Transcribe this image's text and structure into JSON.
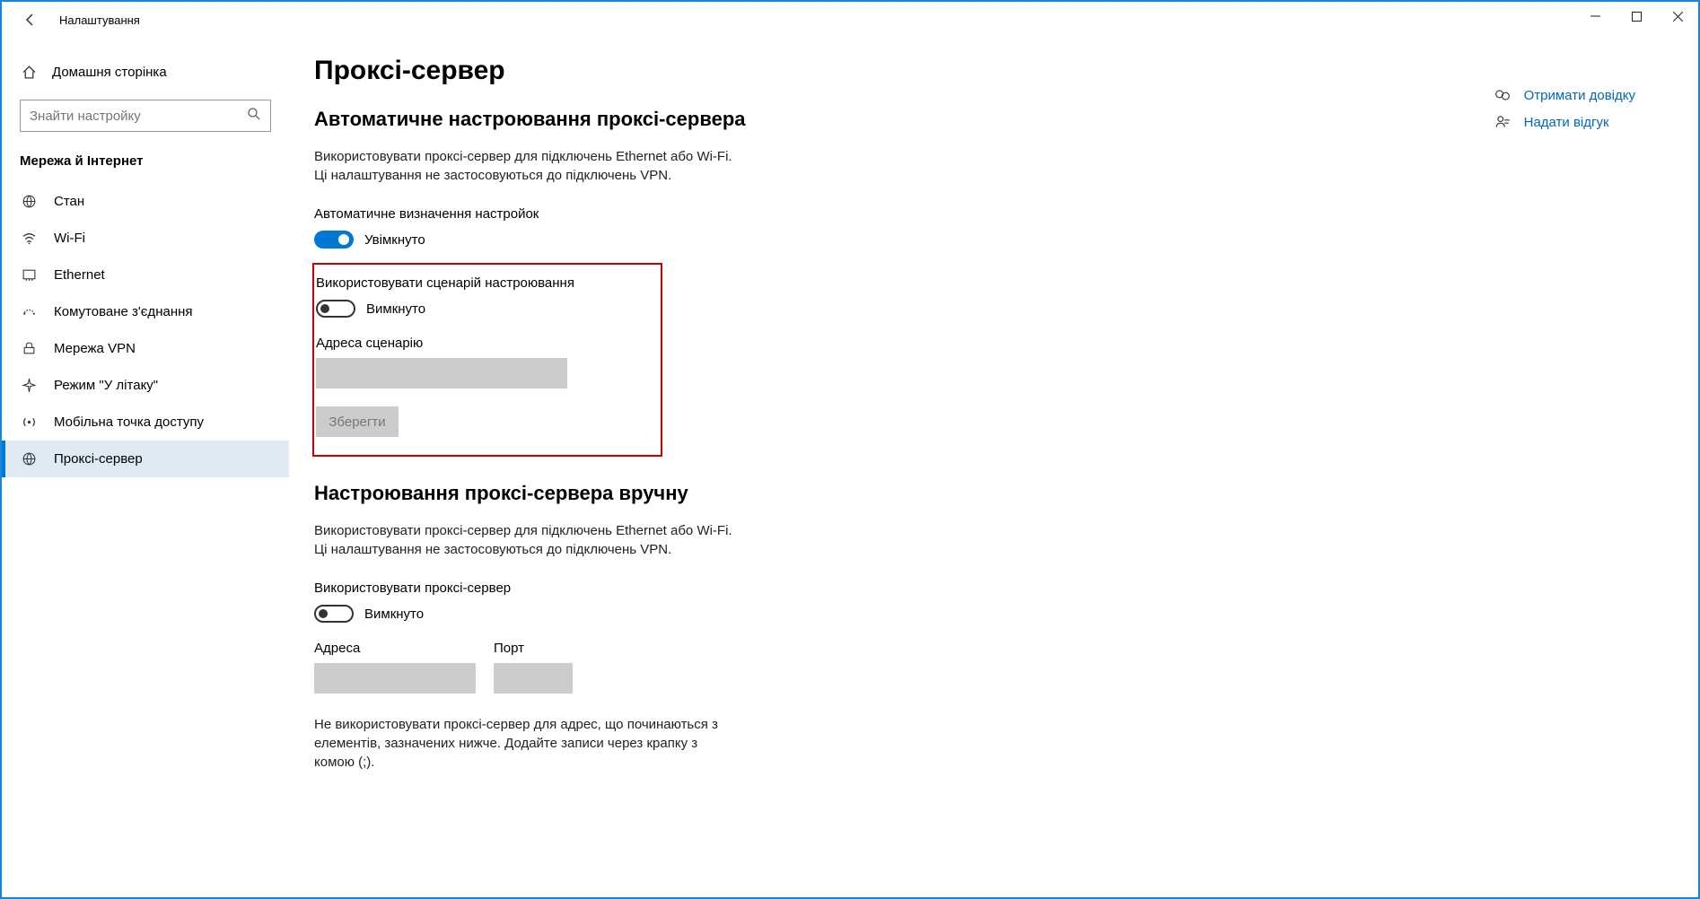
{
  "window": {
    "title": "Налаштування"
  },
  "sidebar": {
    "home": "Домашня сторінка",
    "search_placeholder": "Знайти настройку",
    "category": "Мережа й Інтернет",
    "items": [
      {
        "label": "Стан"
      },
      {
        "label": "Wi-Fi"
      },
      {
        "label": "Ethernet"
      },
      {
        "label": "Комутоване з'єднання"
      },
      {
        "label": "Мережа VPN"
      },
      {
        "label": "Режим \"У літаку\""
      },
      {
        "label": "Мобільна точка доступу"
      },
      {
        "label": "Проксі-сервер"
      }
    ]
  },
  "main": {
    "title": "Проксі-сервер",
    "auto": {
      "heading": "Автоматичне настроювання проксі-сервера",
      "desc1": "Використовувати проксі-сервер для підключень Ethernet або Wi-Fi.",
      "desc2": "Ці налаштування не застосовуються до підключень VPN.",
      "detect_label": "Автоматичне визначення настройок",
      "detect_state": "Увімкнуто",
      "script_label": "Використовувати сценарій настроювання",
      "script_state": "Вимкнуто",
      "script_addr_label": "Адреса сценарію",
      "save_btn": "Зберегти"
    },
    "manual": {
      "heading": "Настроювання проксі-сервера вручну",
      "desc1": "Використовувати проксі-сервер для підключень Ethernet або Wi-Fi.",
      "desc2": "Ці налаштування не застосовуються до підключень VPN.",
      "use_label": "Використовувати проксі-сервер",
      "use_state": "Вимкнуто",
      "addr_label": "Адреса",
      "port_label": "Порт",
      "except_desc": "Не використовувати проксі-сервер для адрес, що починаються з елементів, зазначених нижче. Додайте записи через крапку з комою (;)."
    }
  },
  "links": {
    "help": "Отримати довідку",
    "feedback": "Надати відгук"
  }
}
